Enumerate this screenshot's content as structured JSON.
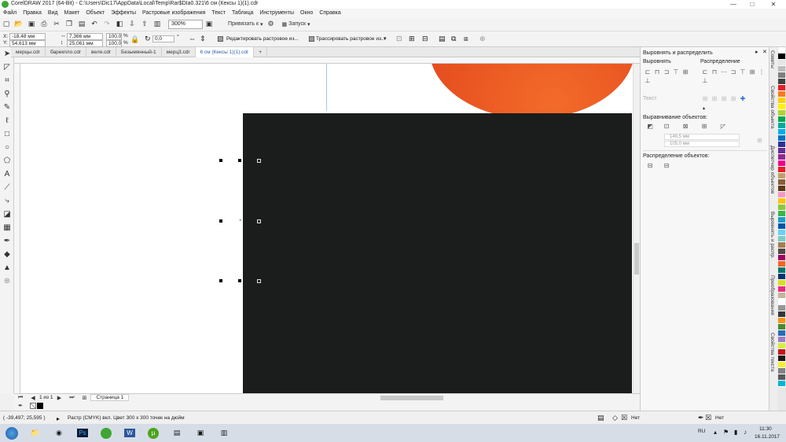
{
  "window": {
    "title": "CorelDRAW 2017 (64-Bit) - C:\\Users\\Dic17\\AppData\\Local\\Temp\\Rar$DIa0.321\\6 см (Кексы 1)(1).cdr",
    "min": "—",
    "max": "□",
    "close": "✕"
  },
  "menu": [
    "Файл",
    "Правка",
    "Вид",
    "Макет",
    "Объект",
    "Эффекты",
    "Растровые изображения",
    "Текст",
    "Таблица",
    "Инструменты",
    "Окно",
    "Справка"
  ],
  "toolbar": {
    "zoom": "300%",
    "snap_label": "Привязать к",
    "launch_label": "Запуск"
  },
  "propbar": {
    "x": "-18,48 мм",
    "y": "54,613 мм",
    "w": "7,366 мм",
    "h": "25,061 мм",
    "sx": "100,0",
    "sy": "100,0",
    "pct1": "%",
    "pct2": "%",
    "angle": "0,0",
    "deg": "°",
    "edit_bitmap": "Редактировать растровое из...",
    "trace_bitmap": "Трассировать растровое из..."
  },
  "tabs": [
    "мерцы.cdr",
    "барекпло.cdr",
    "веля.cdr",
    "Безымянный-1",
    "мерц3.cdr",
    "6 см (Кексы 1)(1).cdr"
  ],
  "active_tab": 5,
  "pagenav": {
    "of_label": "1 из 1",
    "page_tab": "Страница 1"
  },
  "status": {
    "coords": "( -39,497; 25,595 )",
    "info": "Растр (CMYK) вкл. Цвет 300 x 300 точек на дюйм",
    "fill_none": "Нет",
    "outline_none": "Нет"
  },
  "dock": {
    "title": "Выровнять и распределить",
    "align_label": "Выровнять",
    "distribute_label": "Распределение",
    "text_label": "Текст",
    "align_objects_label": "Выравнивание объектов:",
    "val1": "148,5 мм",
    "val2": "105,0 мм",
    "distribute_objects_label": "Распределение объектов:"
  },
  "vtabs": [
    "Советы",
    "Свойства объекта",
    "Диспетчер объектов",
    "Выровнять и распр.",
    "Преобразования",
    "Свойства текста"
  ],
  "palette": [
    "#ffffff",
    "#000000",
    "#e5e5e5",
    "#bdbdbd",
    "#7f7f7f",
    "#404040",
    "#e21f26",
    "#f47b20",
    "#ffd100",
    "#fff200",
    "#b2d235",
    "#00a651",
    "#00a99d",
    "#00aeef",
    "#0072bc",
    "#2e3192",
    "#662d91",
    "#92278f",
    "#ec008c",
    "#ed1c24",
    "#c69c6d",
    "#8b5e3c",
    "#603913",
    "#f49ac1",
    "#ffc40c",
    "#8dc63f",
    "#39b54a",
    "#1b9ec9",
    "#0054a6",
    "#6dcff6",
    "#7accc8",
    "#a67c52",
    "#534741",
    "#9e005d",
    "#f26522",
    "#00746b",
    "#003471",
    "#d7df23",
    "#ee2a7b",
    "#c2b59b",
    "#ffffff",
    "#959595",
    "#363636",
    "#f7941d",
    "#4b8a2e",
    "#2a6bb5",
    "#9b7ec4",
    "#d6ef3e",
    "#c4151c",
    "#1a1a1a",
    "#f9ed32",
    "#808285",
    "#58595b",
    "#00b5d1"
  ],
  "taskbar": {
    "lang": "RU",
    "time": "11:30",
    "date": "16.11.2017"
  },
  "colors": {
    "artboard": "#1b1d1c",
    "circle": "#e8531f"
  }
}
